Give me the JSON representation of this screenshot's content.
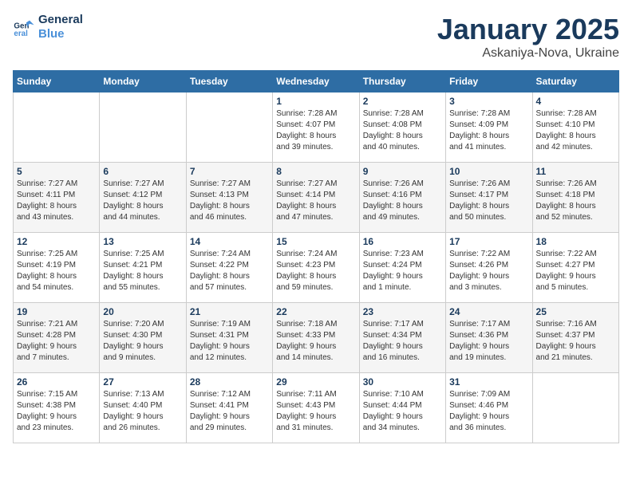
{
  "logo": {
    "line1": "General",
    "line2": "Blue"
  },
  "title": "January 2025",
  "subtitle": "Askaniya-Nova, Ukraine",
  "days_header": [
    "Sunday",
    "Monday",
    "Tuesday",
    "Wednesday",
    "Thursday",
    "Friday",
    "Saturday"
  ],
  "weeks": [
    [
      {
        "day": "",
        "info": ""
      },
      {
        "day": "",
        "info": ""
      },
      {
        "day": "",
        "info": ""
      },
      {
        "day": "1",
        "info": "Sunrise: 7:28 AM\nSunset: 4:07 PM\nDaylight: 8 hours\nand 39 minutes."
      },
      {
        "day": "2",
        "info": "Sunrise: 7:28 AM\nSunset: 4:08 PM\nDaylight: 8 hours\nand 40 minutes."
      },
      {
        "day": "3",
        "info": "Sunrise: 7:28 AM\nSunset: 4:09 PM\nDaylight: 8 hours\nand 41 minutes."
      },
      {
        "day": "4",
        "info": "Sunrise: 7:28 AM\nSunset: 4:10 PM\nDaylight: 8 hours\nand 42 minutes."
      }
    ],
    [
      {
        "day": "5",
        "info": "Sunrise: 7:27 AM\nSunset: 4:11 PM\nDaylight: 8 hours\nand 43 minutes."
      },
      {
        "day": "6",
        "info": "Sunrise: 7:27 AM\nSunset: 4:12 PM\nDaylight: 8 hours\nand 44 minutes."
      },
      {
        "day": "7",
        "info": "Sunrise: 7:27 AM\nSunset: 4:13 PM\nDaylight: 8 hours\nand 46 minutes."
      },
      {
        "day": "8",
        "info": "Sunrise: 7:27 AM\nSunset: 4:14 PM\nDaylight: 8 hours\nand 47 minutes."
      },
      {
        "day": "9",
        "info": "Sunrise: 7:26 AM\nSunset: 4:16 PM\nDaylight: 8 hours\nand 49 minutes."
      },
      {
        "day": "10",
        "info": "Sunrise: 7:26 AM\nSunset: 4:17 PM\nDaylight: 8 hours\nand 50 minutes."
      },
      {
        "day": "11",
        "info": "Sunrise: 7:26 AM\nSunset: 4:18 PM\nDaylight: 8 hours\nand 52 minutes."
      }
    ],
    [
      {
        "day": "12",
        "info": "Sunrise: 7:25 AM\nSunset: 4:19 PM\nDaylight: 8 hours\nand 54 minutes."
      },
      {
        "day": "13",
        "info": "Sunrise: 7:25 AM\nSunset: 4:21 PM\nDaylight: 8 hours\nand 55 minutes."
      },
      {
        "day": "14",
        "info": "Sunrise: 7:24 AM\nSunset: 4:22 PM\nDaylight: 8 hours\nand 57 minutes."
      },
      {
        "day": "15",
        "info": "Sunrise: 7:24 AM\nSunset: 4:23 PM\nDaylight: 8 hours\nand 59 minutes."
      },
      {
        "day": "16",
        "info": "Sunrise: 7:23 AM\nSunset: 4:24 PM\nDaylight: 9 hours\nand 1 minute."
      },
      {
        "day": "17",
        "info": "Sunrise: 7:22 AM\nSunset: 4:26 PM\nDaylight: 9 hours\nand 3 minutes."
      },
      {
        "day": "18",
        "info": "Sunrise: 7:22 AM\nSunset: 4:27 PM\nDaylight: 9 hours\nand 5 minutes."
      }
    ],
    [
      {
        "day": "19",
        "info": "Sunrise: 7:21 AM\nSunset: 4:28 PM\nDaylight: 9 hours\nand 7 minutes."
      },
      {
        "day": "20",
        "info": "Sunrise: 7:20 AM\nSunset: 4:30 PM\nDaylight: 9 hours\nand 9 minutes."
      },
      {
        "day": "21",
        "info": "Sunrise: 7:19 AM\nSunset: 4:31 PM\nDaylight: 9 hours\nand 12 minutes."
      },
      {
        "day": "22",
        "info": "Sunrise: 7:18 AM\nSunset: 4:33 PM\nDaylight: 9 hours\nand 14 minutes."
      },
      {
        "day": "23",
        "info": "Sunrise: 7:17 AM\nSunset: 4:34 PM\nDaylight: 9 hours\nand 16 minutes."
      },
      {
        "day": "24",
        "info": "Sunrise: 7:17 AM\nSunset: 4:36 PM\nDaylight: 9 hours\nand 19 minutes."
      },
      {
        "day": "25",
        "info": "Sunrise: 7:16 AM\nSunset: 4:37 PM\nDaylight: 9 hours\nand 21 minutes."
      }
    ],
    [
      {
        "day": "26",
        "info": "Sunrise: 7:15 AM\nSunset: 4:38 PM\nDaylight: 9 hours\nand 23 minutes."
      },
      {
        "day": "27",
        "info": "Sunrise: 7:13 AM\nSunset: 4:40 PM\nDaylight: 9 hours\nand 26 minutes."
      },
      {
        "day": "28",
        "info": "Sunrise: 7:12 AM\nSunset: 4:41 PM\nDaylight: 9 hours\nand 29 minutes."
      },
      {
        "day": "29",
        "info": "Sunrise: 7:11 AM\nSunset: 4:43 PM\nDaylight: 9 hours\nand 31 minutes."
      },
      {
        "day": "30",
        "info": "Sunrise: 7:10 AM\nSunset: 4:44 PM\nDaylight: 9 hours\nand 34 minutes."
      },
      {
        "day": "31",
        "info": "Sunrise: 7:09 AM\nSunset: 4:46 PM\nDaylight: 9 hours\nand 36 minutes."
      },
      {
        "day": "",
        "info": ""
      }
    ]
  ]
}
